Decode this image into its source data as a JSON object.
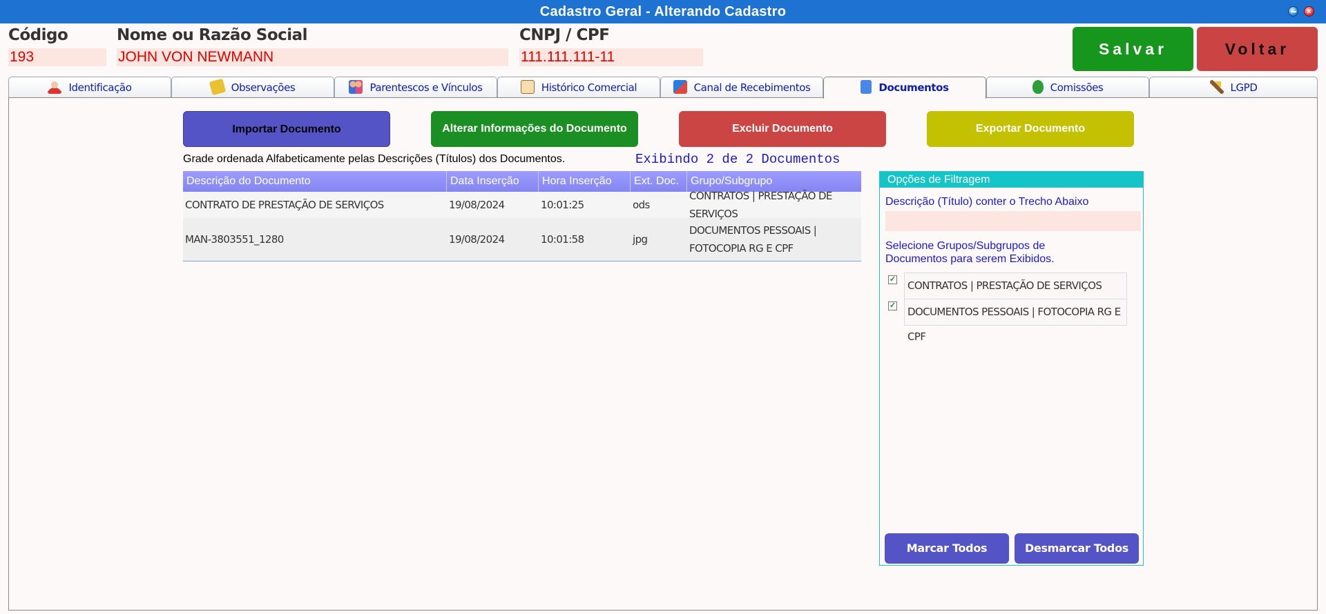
{
  "window": {
    "title": "Cadastro Geral - Alterando Cadastro"
  },
  "header": {
    "codigo_label": "Código",
    "codigo_value": "193",
    "nome_label": "Nome ou Razão Social",
    "nome_value": "JOHN VON NEWMANN",
    "cnpj_label": "CNPJ / CPF",
    "cnpj_value": "111.111.111-11",
    "save_label": "Salvar",
    "back_label": "Voltar"
  },
  "tabs": [
    {
      "label": "Identificação",
      "icon": "person-icon"
    },
    {
      "label": "Observações",
      "icon": "notes-icon"
    },
    {
      "label": "Parentescos e Vínculos",
      "icon": "family-icon"
    },
    {
      "label": "Histórico Comercial",
      "icon": "history-icon"
    },
    {
      "label": "Canal de Recebimentos",
      "icon": "cards-icon"
    },
    {
      "label": "Documentos",
      "icon": "document-icon",
      "active": true
    },
    {
      "label": "Comissões",
      "icon": "money-bag-icon"
    },
    {
      "label": "LGPD",
      "icon": "gavel-icon"
    }
  ],
  "actions": {
    "import": "Importar Documento",
    "alter": "Alterar Informações do  Documento",
    "delete": "Excluir Documento",
    "export": "Exportar Documento"
  },
  "grid": {
    "caption": "Grade ordenada Alfabeticamente pelas Descrições (Títulos) dos Documentos.",
    "count": "Exibindo 2 de 2 Documentos",
    "columns": [
      "Descrição do Documento",
      "Data Inserção",
      "Hora Inserção",
      "Ext. Doc.",
      "Grupo/Subgrupo"
    ],
    "rows": [
      [
        "CONTRATO DE PRESTAÇÃO DE SERVIÇOS",
        "19/08/2024",
        "10:01:25",
        "ods",
        "CONTRATOS | PRESTAÇÃO DE SERVIÇOS"
      ],
      [
        "MAN-3803551_1280",
        "19/08/2024",
        "10:01:58",
        "jpg",
        "DOCUMENTOS PESSOAIS | FOTOCOPIA RG E CPF"
      ]
    ]
  },
  "filter": {
    "title": "Opções de Filtragem",
    "desc_label": "Descrição (Título) conter o Trecho Abaixo",
    "desc_value": "",
    "groups_label": "Selecione Grupos/Subgrupos de Documentos para serem Exibidos.",
    "groups": [
      {
        "label": "CONTRATOS | PRESTAÇÃO DE SERVIÇOS",
        "checked": true
      },
      {
        "label": "DOCUMENTOS PESSOAIS | FOTOCOPIA RG E CPF",
        "checked": true
      }
    ],
    "mark_all": "Marcar Todos",
    "unmark_all": "Desmarcar Todos"
  },
  "colors": {
    "titlebar": "#1e73d2",
    "save": "#16961d",
    "back": "#cb4444",
    "import": "#5454c6",
    "alter": "#1b8f23",
    "delete": "#cc4545",
    "export": "#c3c101",
    "filter_header": "#14c4c6",
    "value_text": "#e00000"
  }
}
